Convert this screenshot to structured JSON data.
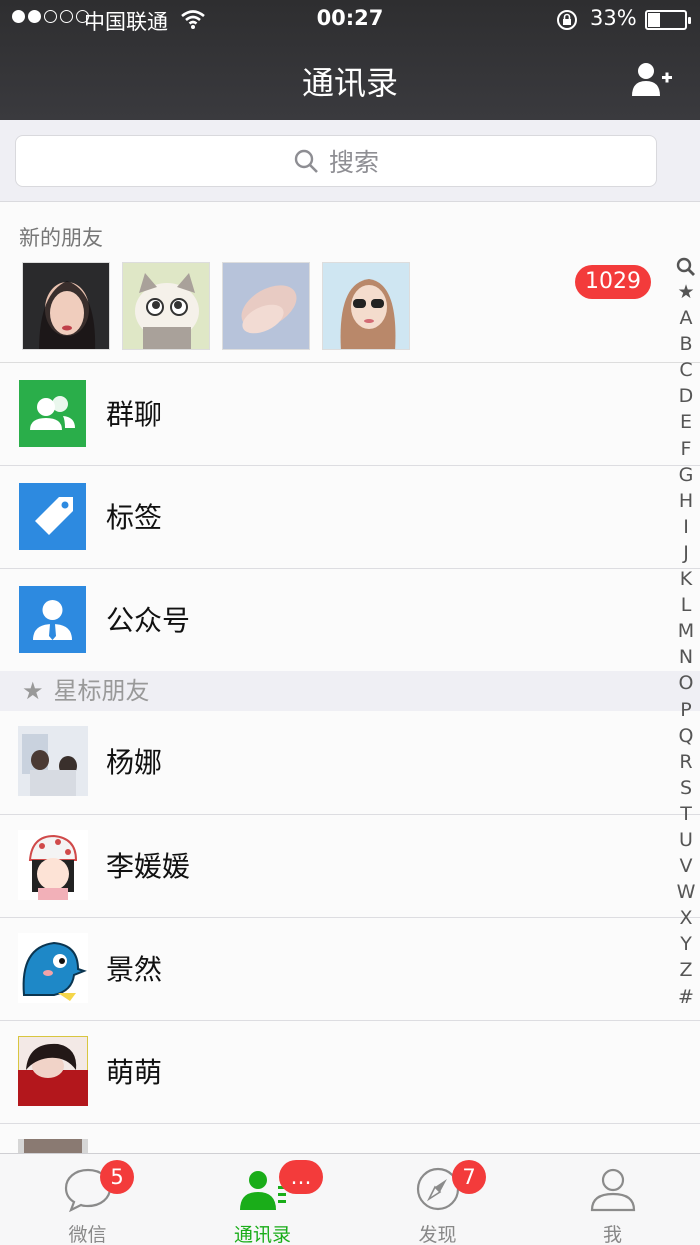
{
  "status_bar": {
    "carrier": "中国联通",
    "time": "00:27",
    "battery": "33%",
    "battery_level": 0.33
  },
  "nav": {
    "title": "通讯录",
    "add_icon": "add-contact-icon"
  },
  "search": {
    "placeholder": "搜索"
  },
  "new_friends": {
    "title": "新的朋友",
    "badge": "1029",
    "avatars": [
      "avatar-girl-portrait",
      "avatar-cartoon-cat",
      "avatar-holding-hands",
      "avatar-girl-sunglasses"
    ]
  },
  "features": [
    {
      "label": "群聊",
      "icon": "group-chat-icon",
      "color": "#2aae4a"
    },
    {
      "label": "标签",
      "icon": "tag-icon",
      "color": "#2d8ae0"
    },
    {
      "label": "公众号",
      "icon": "official-account-icon",
      "color": "#2d8ae0"
    }
  ],
  "starred": {
    "header": "星标朋友",
    "contacts": [
      {
        "name": "杨娜"
      },
      {
        "name": "李媛媛"
      },
      {
        "name": "景然"
      },
      {
        "name": "萌萌"
      }
    ]
  },
  "index_letters": [
    "★",
    "A",
    "B",
    "C",
    "D",
    "E",
    "F",
    "G",
    "H",
    "I",
    "J",
    "K",
    "L",
    "M",
    "N",
    "O",
    "P",
    "Q",
    "R",
    "S",
    "T",
    "U",
    "V",
    "W",
    "X",
    "Y",
    "Z",
    "#"
  ],
  "tabs": [
    {
      "label": "微信",
      "badge": "5",
      "icon": "chat-bubble-icon"
    },
    {
      "label": "通讯录",
      "badge": "…",
      "icon": "contacts-icon",
      "active": true
    },
    {
      "label": "发现",
      "badge": "7",
      "icon": "compass-icon"
    },
    {
      "label": "我",
      "badge": "",
      "icon": "profile-icon"
    }
  ],
  "colors": {
    "accent_green": "#1aad19",
    "badge_red": "#f33b3b",
    "nav_dark": "#333336"
  }
}
